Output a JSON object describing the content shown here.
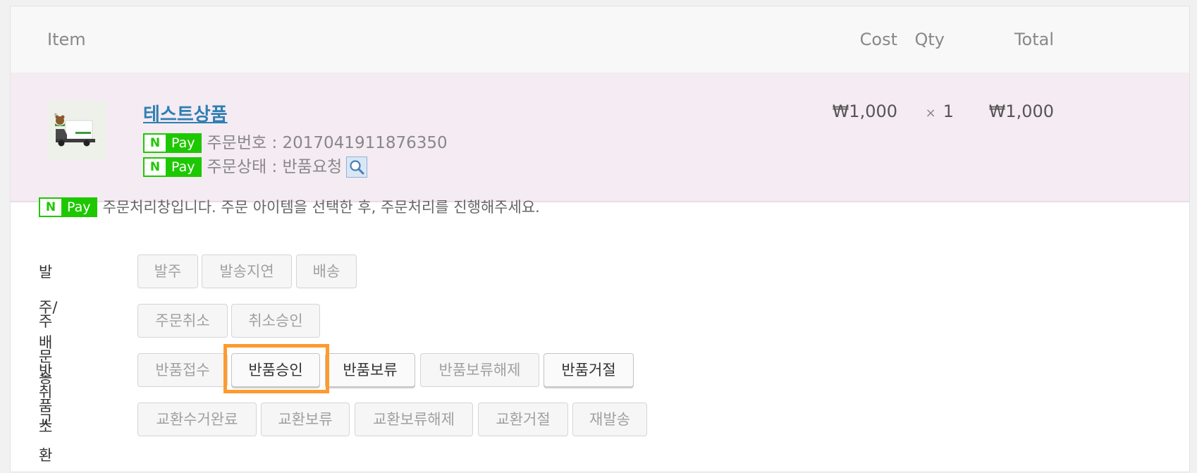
{
  "table": {
    "headers": {
      "item": "Item",
      "cost": "Cost",
      "qty": "Qty",
      "total": "Total"
    },
    "row": {
      "product_name": "테스트상품",
      "npay_badge": {
        "n": "N",
        "pay": "Pay"
      },
      "order_number": "주문번호 : 2017041911876350",
      "order_status": "주문상태 : 반품요청",
      "cost": "₩1,000",
      "qty_symbol": "×",
      "qty": "1",
      "total": "₩1,000"
    }
  },
  "actions": {
    "notice": "주문처리창입니다. 주문 아이템을 선택한 후, 주문처리를 진행해주세요.",
    "groups": [
      {
        "label": "발주/배송",
        "buttons": [
          "발주",
          "발송지연",
          "배송"
        ]
      },
      {
        "label": "주문취소",
        "buttons": [
          "주문취소",
          "취소승인"
        ]
      },
      {
        "label": "반품",
        "buttons": [
          "반품접수",
          "반품승인",
          "반품보류",
          "반품보류해제",
          "반품거절"
        ]
      },
      {
        "label": "교환",
        "buttons": [
          "교환수거완료",
          "교환보류",
          "교환보류해제",
          "교환거절",
          "재발송"
        ]
      }
    ]
  },
  "colors": {
    "npay_green": "#1ec800",
    "highlight": "#ff9a2e",
    "link": "#2f7fb3",
    "row_bg": "#f5ebf2"
  },
  "icons": [
    "product-truck-icon",
    "search-icon"
  ]
}
